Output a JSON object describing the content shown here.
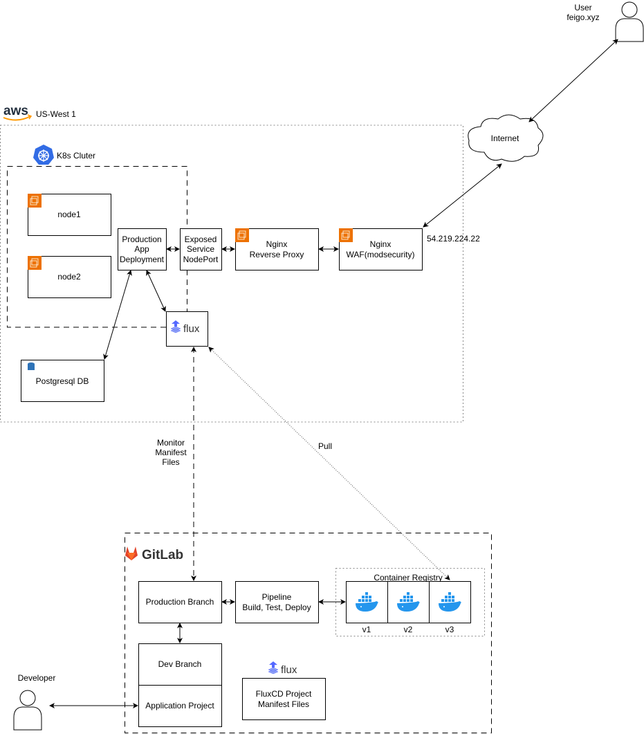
{
  "user": {
    "label": "User",
    "host": "feigo.xyz"
  },
  "internet": {
    "label": "Internet"
  },
  "aws": {
    "region": "US-West 1",
    "logo_text": "aws"
  },
  "k8s": {
    "label": "K8s Cluter"
  },
  "nodes": [
    {
      "label": "node1"
    },
    {
      "label": "node2"
    }
  ],
  "prod_app": {
    "lines": [
      "Production",
      "App",
      "Deployment"
    ]
  },
  "exposed": {
    "lines": [
      "Exposed",
      "Service",
      "NodePort"
    ]
  },
  "nginx_proxy": {
    "lines": [
      "Nginx",
      "Reverse Proxy"
    ]
  },
  "nginx_waf": {
    "lines": [
      "Nginx",
      "WAF(modsecurity)"
    ]
  },
  "ip": "54.219.224.22",
  "flux": {
    "label": "flux"
  },
  "postgres": {
    "label": "Postgresql DB"
  },
  "monitor": {
    "lines": [
      "Monitor",
      "Manifest",
      "Files"
    ]
  },
  "pull": {
    "label": "Pull"
  },
  "gitlab": {
    "label": "GitLab"
  },
  "prod_branch": {
    "label": "Production Branch"
  },
  "pipeline": {
    "lines": [
      "Pipeline",
      "Build, Test, Deploy"
    ]
  },
  "registry": {
    "label": "Container Registry",
    "versions": [
      "v1",
      "v2",
      "v3"
    ]
  },
  "dev_branch": {
    "label": "Dev Branch"
  },
  "app_project": {
    "label": "Application Project"
  },
  "fluxcd": {
    "lines": [
      "FluxCD Project",
      "Manifest Files"
    ],
    "logo": "flux"
  },
  "developer": {
    "label": "Developer"
  },
  "colors": {
    "aws_orange": "#ED7100",
    "k8s_blue": "#326CE5",
    "gitlab_orange": "#E24329",
    "docker_blue": "#2496ED",
    "flux_blue": "#5468FF"
  }
}
